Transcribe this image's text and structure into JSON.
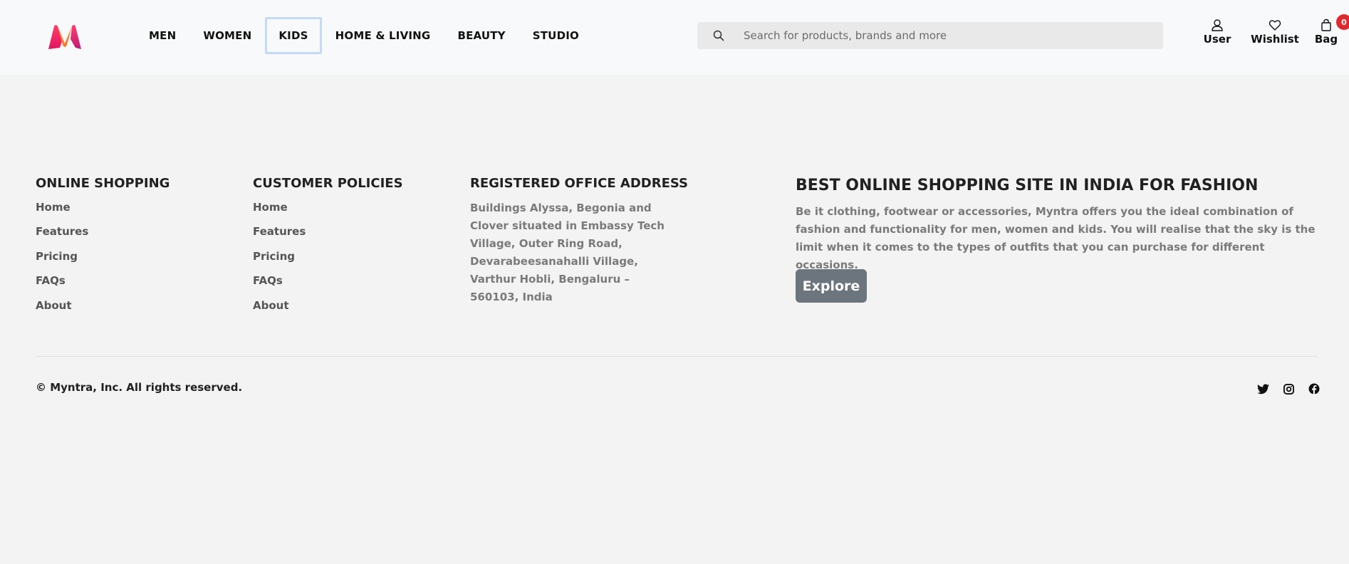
{
  "header": {
    "nav": [
      {
        "label": "MEN"
      },
      {
        "label": "WOMEN"
      },
      {
        "label": "KIDS",
        "active": true
      },
      {
        "label": "HOME & LIVING"
      },
      {
        "label": "BEAUTY"
      },
      {
        "label": "STUDIO"
      }
    ],
    "search": {
      "placeholder": "Search for products, brands and more",
      "value": ""
    },
    "actions": {
      "user_label": "User",
      "wishlist_label": "Wishlist",
      "bag_label": "Bag",
      "bag_count": "0"
    },
    "logo_icon": "myntra-logo",
    "colors": {
      "badge": "#e0282e",
      "active_outline": "#c3dbf7"
    }
  },
  "footer": {
    "online_shopping": {
      "title": "ONLINE SHOPPING",
      "links": [
        "Home",
        "Features",
        "Pricing",
        "FAQs",
        "About"
      ]
    },
    "customer_policies": {
      "title": "CUSTOMER POLICIES",
      "links": [
        "Home",
        "Features",
        "Pricing",
        "FAQs",
        "About"
      ]
    },
    "office": {
      "title": "REGISTERED OFFICE ADDRESS",
      "address": "Buildings Alyssa, Begonia and Clover situated in Embassy Tech Village, Outer Ring Road, Devarabeesanahalli Village, Varthur Hobli, Bengaluru – 560103, India"
    },
    "promo": {
      "title": "BEST ONLINE SHOPPING SITE IN INDIA FOR FASHION",
      "text": "Be it clothing, footwear or accessories, Myntra offers you the ideal combination of fashion and functionality for men, women and kids. You will realise that the sky is the limit when it comes to the types of outfits that you can purchase for different occasions.",
      "button": "Explore"
    },
    "copyright": "© Myntra, Inc. All rights reserved.",
    "socials": [
      "twitter-icon",
      "instagram-icon",
      "facebook-icon"
    ]
  }
}
